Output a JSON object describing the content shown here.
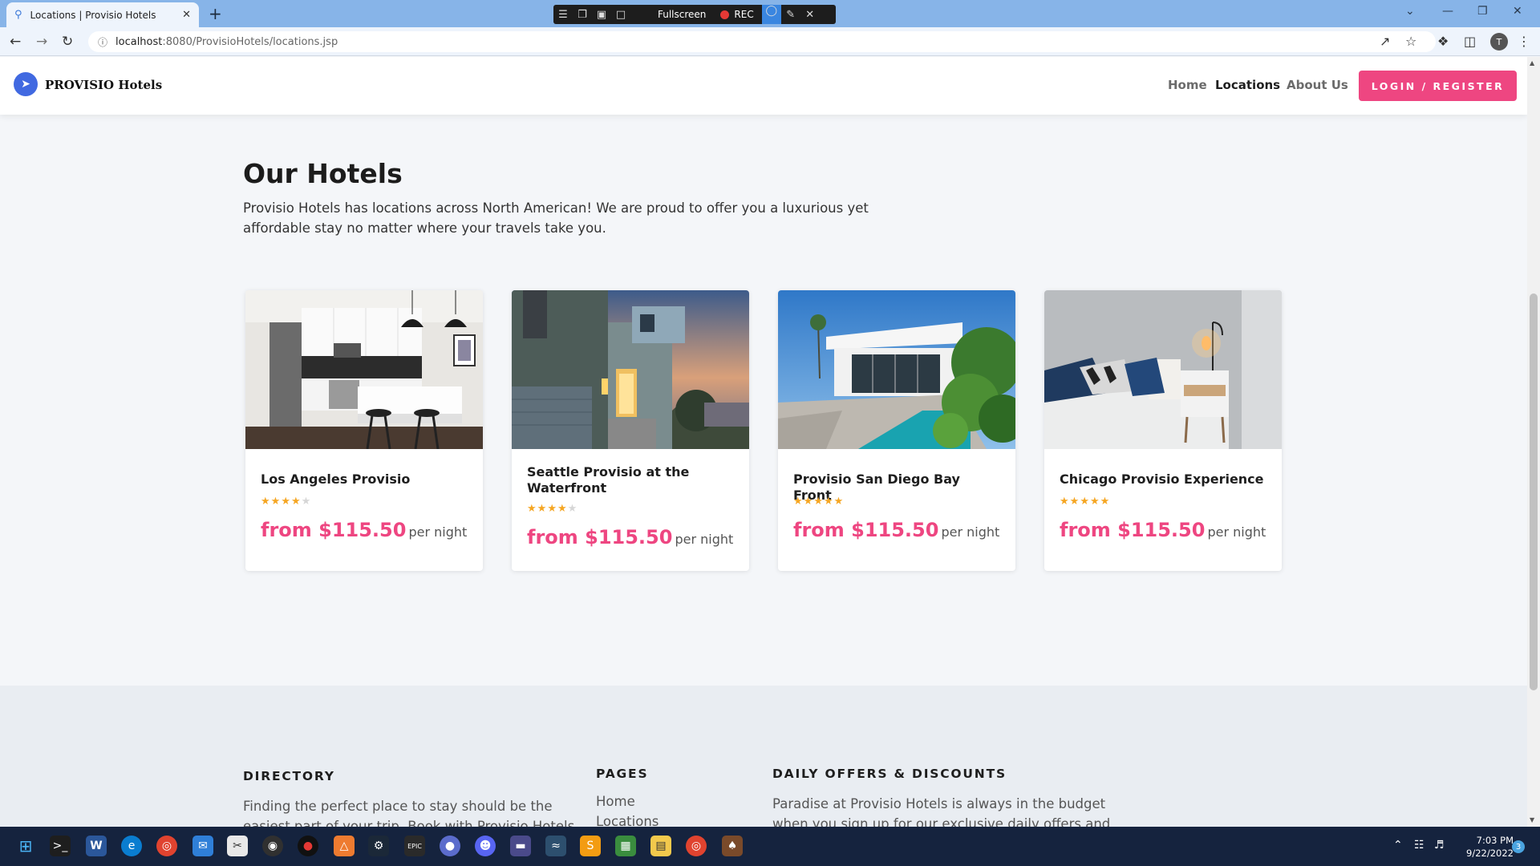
{
  "browser": {
    "tab_title": "Locations | Provisio Hotels",
    "new_tab": "+",
    "url_host": "localhost",
    "url_path": ":8080/ProvisioHotels/locations.jsp",
    "recorder": {
      "fullscreen_label": "Fullscreen",
      "rec_label": "REC"
    },
    "profile_initial": "T"
  },
  "site": {
    "brand": "PROVISIO Hotels",
    "nav": {
      "home": "Home",
      "locations": "Locations",
      "about": "About Us"
    },
    "login_label": "LOGIN / REGISTER"
  },
  "main": {
    "heading": "Our Hotels",
    "intro": "Provisio Hotels has locations across North American! We are proud to offer you a luxurious yet affordable stay no matter where your travels take you."
  },
  "hotels": [
    {
      "name": "Los Angeles Provisio",
      "rating": 4,
      "rating_max": 5,
      "price": "from $115.50",
      "per": "per night"
    },
    {
      "name": "Seattle Provisio at the Waterfront",
      "rating": 4,
      "rating_max": 5,
      "price": "from $115.50",
      "per": "per night"
    },
    {
      "name": "Provisio San Diego Bay Front",
      "rating": 5,
      "rating_max": 5,
      "price": "from $115.50",
      "per": "per night"
    },
    {
      "name": "Chicago Provisio Experience",
      "rating": 5,
      "rating_max": 5,
      "price": "from $115.50",
      "per": "per night"
    }
  ],
  "footer": {
    "directory": {
      "title": "DIRECTORY",
      "text_line1": "Finding the perfect place to stay should be the",
      "text_line2": "easiest part of your trip. Book with Provisio Hotels"
    },
    "pages": {
      "title": "PAGES",
      "home": "Home",
      "locations": "Locations"
    },
    "offers": {
      "title": "DAILY OFFERS & DISCOUNTS",
      "text_line1": "Paradise at Provisio Hotels is always in the budget",
      "text_line2": "when you sign up for our exclusive daily offers and"
    }
  },
  "taskbar": {
    "time": "7:03 PM",
    "date": "9/22/2022",
    "notifications": "3"
  },
  "colors": {
    "accent": "#ee4681",
    "star": "#f5a623",
    "logo": "#4169e1"
  }
}
